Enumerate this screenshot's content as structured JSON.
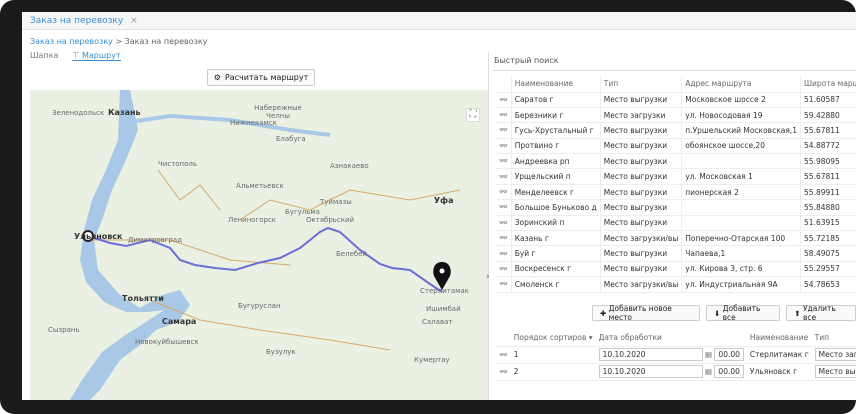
{
  "tab": {
    "title": "Заказ на перевозку",
    "close": "×"
  },
  "breadcrumb": {
    "parent": "Заказ на перевозку",
    "sep": ">",
    "current": "Заказ на перевозку"
  },
  "subtabs": {
    "first": "Шапка",
    "second": "Маршрут"
  },
  "map": {
    "calc_button": "Расчитать маршрут",
    "fullscreen": "⛶",
    "labels": [
      {
        "t": "Зеленодольск"
      },
      {
        "t": "Казань"
      },
      {
        "t": "Нижнекамск"
      },
      {
        "t": "Набережные Челны"
      },
      {
        "t": "Альметьевск"
      },
      {
        "t": "Бугульма"
      },
      {
        "t": "Уфа"
      },
      {
        "t": "Ульяновск"
      },
      {
        "t": "Димитровград"
      },
      {
        "t": "Тольятти"
      },
      {
        "t": "Самара"
      },
      {
        "t": "Новокуйбышевск"
      },
      {
        "t": "Сызрань"
      },
      {
        "t": "Стерлитамак"
      },
      {
        "t": "Октябрьский"
      },
      {
        "t": "Туймазы"
      },
      {
        "t": "Белебей"
      },
      {
        "t": "Ишимбай"
      },
      {
        "t": "Салават"
      },
      {
        "t": "Кумертау"
      },
      {
        "t": "Бузулук"
      },
      {
        "t": "Лениногорск"
      },
      {
        "t": "Азнакаево"
      },
      {
        "t": "Чистополь"
      },
      {
        "t": "Елабуга"
      },
      {
        "t": "Бугуруслан"
      }
    ]
  },
  "panel": {
    "quick_search": "Быстрый поиск",
    "columns": [
      "Наименование",
      "Тип",
      "Адрес маршрута",
      "Широта маршру"
    ],
    "rows": [
      {
        "name": "Саратов г",
        "type": "Место выгрузки",
        "addr": "Московское шоссе 2",
        "lat": "51.60587"
      },
      {
        "name": "Березники г",
        "type": "Место загрузки",
        "addr": "ул. Новосодовая 19",
        "lat": "59.42880"
      },
      {
        "name": "Гусь-Хрустальный г",
        "type": "Место выгрузки",
        "addr": "п.Уршельский Московская,1",
        "lat": "55.67811"
      },
      {
        "name": "Протвино г",
        "type": "Место выгрузки",
        "addr": "обоянское шоссе,20",
        "lat": "54.88772"
      },
      {
        "name": "Андреевка рп",
        "type": "Место выгрузки",
        "addr": "",
        "lat": "55.98095"
      },
      {
        "name": "Урщельский п",
        "type": "Место выгрузки",
        "addr": "ул. Московская 1",
        "lat": "55.67811"
      },
      {
        "name": "Менделеевск г",
        "type": "Место выгрузки",
        "addr": "пионерская 2",
        "lat": "55.89911"
      },
      {
        "name": "Большое Буньково д",
        "type": "Место выгрузки",
        "addr": "",
        "lat": "55.84880"
      },
      {
        "name": "Зоринский п",
        "type": "Место выгрузки",
        "addr": "",
        "lat": "51.63915"
      },
      {
        "name": "Казань г",
        "type": "Место загрузки/вы",
        "addr": "Поперечно-Отарская 100",
        "lat": "55.72185"
      },
      {
        "name": "Буй г",
        "type": "Место выгрузки",
        "addr": "Чапаева,1",
        "lat": "58.49075"
      },
      {
        "name": "Воскресенск г",
        "type": "Место выгрузки",
        "addr": "ул. Кирова 3, стр. 6",
        "lat": "55.29557"
      },
      {
        "name": "Смоленск г",
        "type": "Место загрузки/вы",
        "addr": "ул. Индустриальная 9А",
        "lat": "54.78653"
      }
    ],
    "btn_add_new": "Добавить новое место",
    "btn_add_all": "Добавить все",
    "btn_remove_all": "Удалить все",
    "route_columns": [
      "Порядок сортиров",
      "Дата обработки",
      "Наименование",
      "Тип"
    ],
    "route_rows": [
      {
        "order": "1",
        "date": "10.10.2020",
        "time": "00.00",
        "name": "Стерлитамак г",
        "type": "Место загрузк"
      },
      {
        "order": "2",
        "date": "10.10.2020",
        "time": "00.00",
        "name": "Ульяновск г",
        "type": "Место выгруз"
      }
    ]
  },
  "colors": {
    "accent": "#3a8fd4",
    "route": "#6b6fd6",
    "water": "#a9c8e8"
  }
}
